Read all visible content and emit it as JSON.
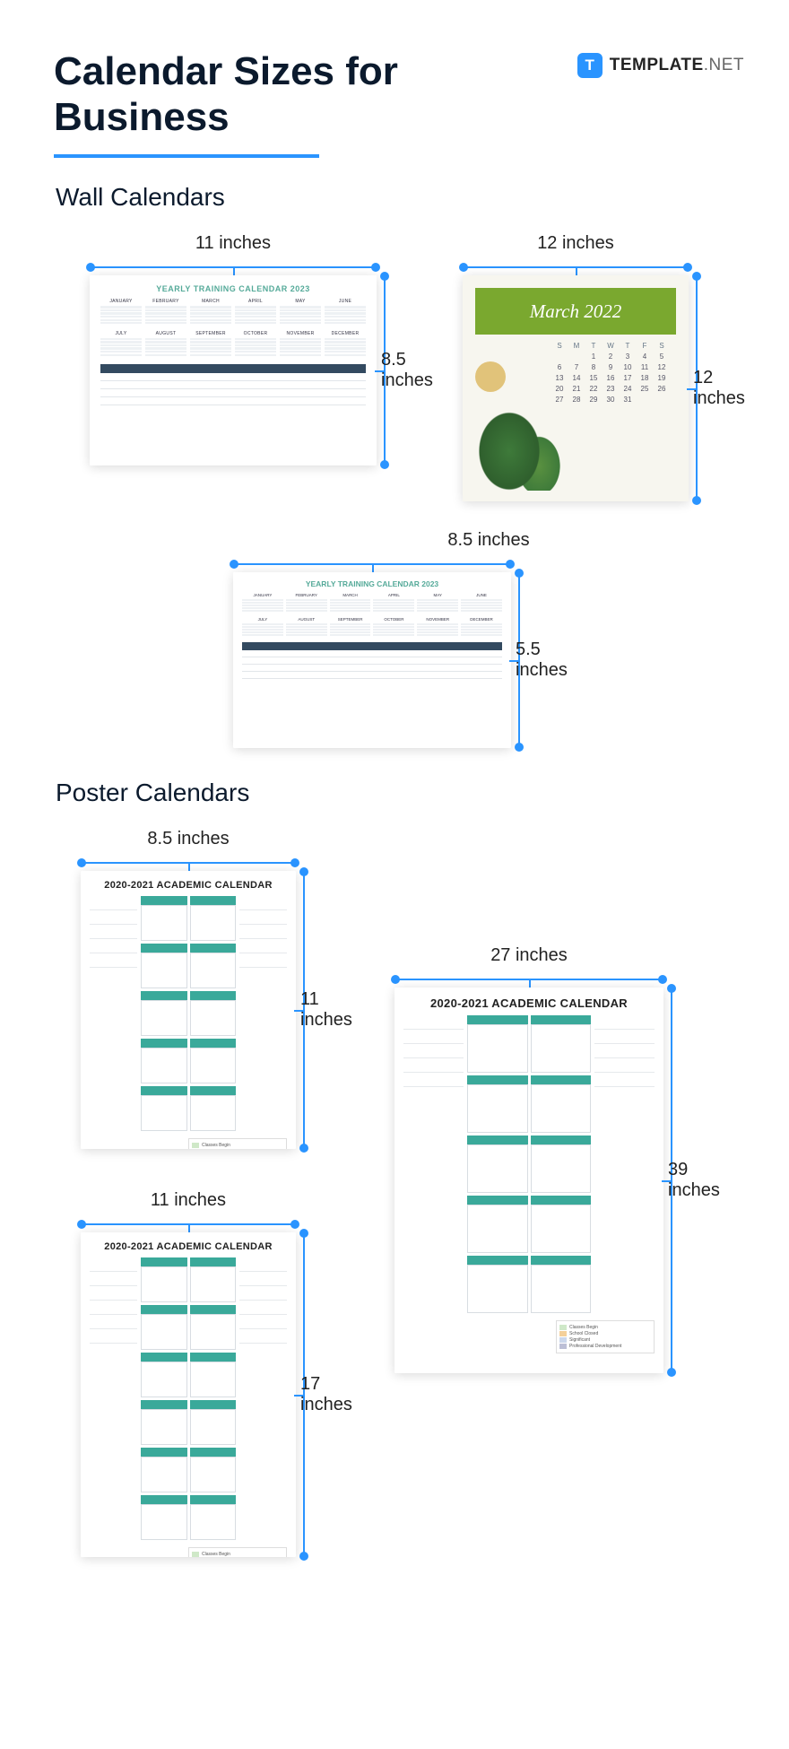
{
  "header": {
    "title": "Calendar Sizes for Business",
    "brand_icon_letter": "T",
    "brand_name_1": "TEMPLATE",
    "brand_name_2": ".NET"
  },
  "sections": {
    "wall": "Wall Calendars",
    "poster": "Poster Calendars"
  },
  "wall": {
    "w1": {
      "width": "11 inches",
      "height": "8.5 inches",
      "caption": "YEARLY TRAINING CALENDAR",
      "year": " 2023",
      "months_top": [
        "JANUARY",
        "FEBRUARY",
        "MARCH",
        "APRIL",
        "MAY",
        "JUNE"
      ],
      "months_bot": [
        "JULY",
        "AUGUST",
        "SEPTEMBER",
        "OCTOBER",
        "NOVEMBER",
        "DECEMBER"
      ]
    },
    "w2": {
      "width": "12 inches",
      "height": "12 inches",
      "month": "March 2022",
      "weekdays": [
        "S",
        "M",
        "T",
        "W",
        "T",
        "F",
        "S"
      ],
      "rows": [
        [
          "",
          "",
          "1",
          "2",
          "3",
          "4",
          "5"
        ],
        [
          "6",
          "7",
          "8",
          "9",
          "10",
          "11",
          "12"
        ],
        [
          "13",
          "14",
          "15",
          "16",
          "17",
          "18",
          "19"
        ],
        [
          "20",
          "21",
          "22",
          "23",
          "24",
          "25",
          "26"
        ],
        [
          "27",
          "28",
          "29",
          "30",
          "31",
          "",
          ""
        ]
      ]
    },
    "w3": {
      "width": "8.5 inches",
      "height": "5.5 inches",
      "caption": "YEARLY TRAINING CALENDAR",
      "year": " 2023"
    }
  },
  "poster": {
    "p1": {
      "width": "8.5 inches",
      "height": "11 inches",
      "caption": "2020-2021 ACADEMIC CALENDAR"
    },
    "p2": {
      "width": "11 inches",
      "height": "17 inches",
      "caption": "2020-2021 ACADEMIC CALENDAR"
    },
    "p3": {
      "width": "27 inches",
      "height": "39 inches",
      "caption": "2020-2021 ACADEMIC CALENDAR"
    },
    "legend": [
      "Classes Begin",
      "School Closed",
      "Significant",
      "Professional Development"
    ],
    "legend_colors": [
      "#cfe8c8",
      "#f4d09a",
      "#cbd7ec",
      "#bcbfd6"
    ]
  }
}
